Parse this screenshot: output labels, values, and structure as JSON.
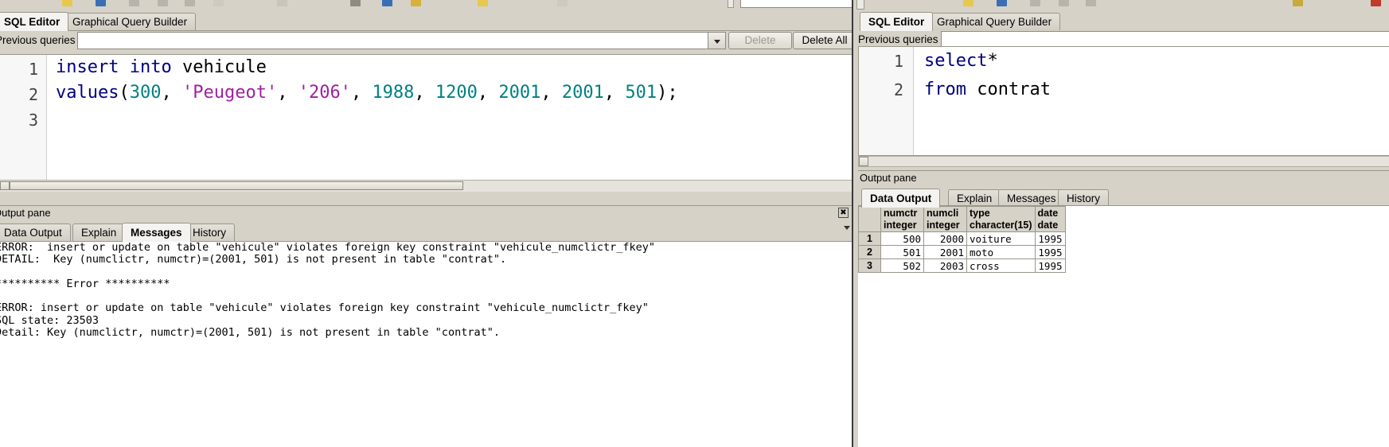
{
  "window_left": {
    "tabs": [
      {
        "label": "SQL Editor",
        "active": true
      },
      {
        "label": "Graphical Query Builder",
        "active": false
      }
    ],
    "previous_queries": {
      "label": "Previous queries",
      "value": "",
      "placeholder": ""
    },
    "buttons": {
      "delete": "Delete",
      "delete_all": "Delete All"
    },
    "editor": {
      "line_numbers": [
        "1",
        "2",
        "3"
      ],
      "lines": [
        {
          "tokens": [
            {
              "t": "insert into ",
              "c": "k"
            },
            {
              "t": "vehicule",
              "c": "plain"
            }
          ]
        },
        {
          "tokens": [
            {
              "t": "values",
              "c": "k"
            },
            {
              "t": "(",
              "c": "plain"
            },
            {
              "t": "300",
              "c": "num-lit"
            },
            {
              "t": ", ",
              "c": "plain"
            },
            {
              "t": "'Peugeot'",
              "c": "str"
            },
            {
              "t": ", ",
              "c": "plain"
            },
            {
              "t": "'206'",
              "c": "str"
            },
            {
              "t": ", ",
              "c": "plain"
            },
            {
              "t": "1988",
              "c": "num-lit"
            },
            {
              "t": ", ",
              "c": "plain"
            },
            {
              "t": "1200",
              "c": "num-lit"
            },
            {
              "t": ", ",
              "c": "plain"
            },
            {
              "t": "2001",
              "c": "num-lit"
            },
            {
              "t": ", ",
              "c": "plain"
            },
            {
              "t": "2001",
              "c": "num-lit"
            },
            {
              "t": ", ",
              "c": "plain"
            },
            {
              "t": "501",
              "c": "num-lit"
            },
            {
              "t": ");",
              "c": "plain"
            }
          ]
        },
        {
          "tokens": []
        }
      ],
      "plain_text": "insert into vehicule\nvalues(300, 'Peugeot', '206', 1988, 1200, 2001, 2001, 501);\n"
    },
    "output_pane": {
      "title": "Output pane",
      "tabs": [
        {
          "label": "Data Output",
          "active": false
        },
        {
          "label": "Explain",
          "active": false
        },
        {
          "label": "Messages",
          "active": true
        },
        {
          "label": "History",
          "active": false
        }
      ],
      "messages": "ERROR:  insert or update on table \"vehicule\" violates foreign key constraint \"vehicule_numclictr_fkey\"\nDETAIL:  Key (numclictr, numctr)=(2001, 501) is not present in table \"contrat\".\n\n********** Error **********\n\nERROR: insert or update on table \"vehicule\" violates foreign key constraint \"vehicule_numclictr_fkey\"\nSQL state: 23503\nDetail: Key (numclictr, numctr)=(2001, 501) is not present in table \"contrat\"."
    }
  },
  "window_right": {
    "tabs": [
      {
        "label": "SQL Editor",
        "active": true
      },
      {
        "label": "Graphical Query Builder",
        "active": false
      }
    ],
    "previous_queries": {
      "label": "Previous queries",
      "value": ""
    },
    "editor": {
      "line_numbers": [
        "1",
        "2"
      ],
      "lines": [
        {
          "tokens": [
            {
              "t": "select",
              "c": "k"
            },
            {
              "t": "*",
              "c": "plain"
            }
          ]
        },
        {
          "tokens": [
            {
              "t": "from ",
              "c": "k"
            },
            {
              "t": "contrat",
              "c": "plain"
            }
          ]
        }
      ],
      "plain_text": "select*\nfrom contrat"
    },
    "output_pane": {
      "title": "Output pane",
      "tabs": [
        {
          "label": "Data Output",
          "active": true
        },
        {
          "label": "Explain",
          "active": false
        },
        {
          "label": "Messages",
          "active": false
        },
        {
          "label": "History",
          "active": false
        }
      ],
      "grid": {
        "columns": [
          {
            "name": "numctr",
            "type": "integer"
          },
          {
            "name": "numcli",
            "type": "integer"
          },
          {
            "name": "type",
            "type": "character(15)"
          },
          {
            "name": "date",
            "type": "date"
          }
        ],
        "rows": [
          {
            "n": "1",
            "cells": [
              "500",
              "2000",
              "voiture",
              "1995"
            ]
          },
          {
            "n": "2",
            "cells": [
              "501",
              "2001",
              "moto",
              "1995"
            ]
          },
          {
            "n": "3",
            "cells": [
              "502",
              "2003",
              "cross",
              "1995"
            ]
          }
        ]
      }
    }
  },
  "colors": {
    "panel": "#d6d2c8",
    "keyword": "#000080",
    "number": "#008080",
    "string": "#a020a0",
    "editor_bg": "#ffffff"
  }
}
